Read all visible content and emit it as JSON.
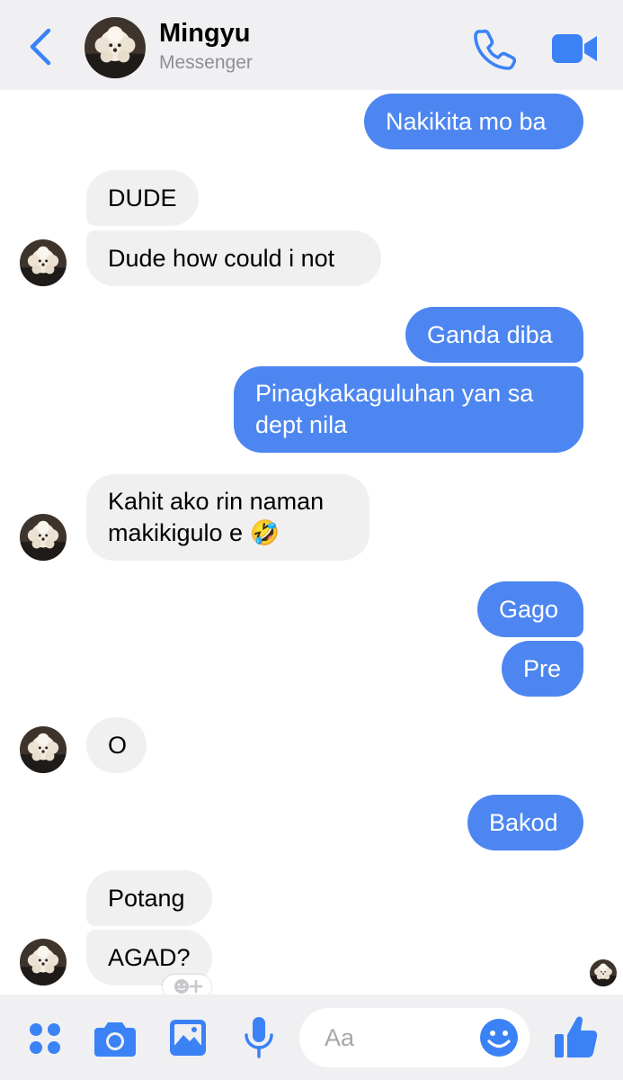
{
  "header": {
    "contact_name": "Mingyu",
    "contact_subtitle": "Messenger"
  },
  "messages": [
    {
      "direction": "outgoing",
      "text": "Nakikita mo ba"
    },
    {
      "direction": "incoming",
      "text": "DUDE"
    },
    {
      "direction": "incoming",
      "text": "Dude how could i not"
    },
    {
      "direction": "outgoing",
      "text": "Ganda diba"
    },
    {
      "direction": "outgoing",
      "text": "Pinagkakaguluhan yan sa dept nila"
    },
    {
      "direction": "incoming",
      "text": "Kahit ako rin naman makikigulo e 🤣"
    },
    {
      "direction": "outgoing",
      "text": "Gago"
    },
    {
      "direction": "outgoing",
      "text": "Pre"
    },
    {
      "direction": "incoming",
      "text": "O"
    },
    {
      "direction": "outgoing",
      "text": "Bakod"
    },
    {
      "direction": "incoming",
      "text": "Potang"
    },
    {
      "direction": "incoming",
      "text": "AGAD?"
    }
  ],
  "composer": {
    "placeholder": "Aa"
  },
  "icons": {
    "back": "chevron-left-icon",
    "call": "phone-icon",
    "video": "video-camera-icon",
    "menu": "four-dots-icon",
    "camera": "camera-icon",
    "gallery": "photo-icon",
    "voice": "microphone-icon",
    "emoji": "smiley-icon",
    "like": "thumbs-up-icon",
    "reaction": "add-reaction-icon"
  },
  "colors": {
    "accent": "#3b82f6",
    "outgoing_bubble": "#4d86f0",
    "incoming_bubble": "#f0f0f0",
    "bar_background": "#f0f0f2"
  }
}
